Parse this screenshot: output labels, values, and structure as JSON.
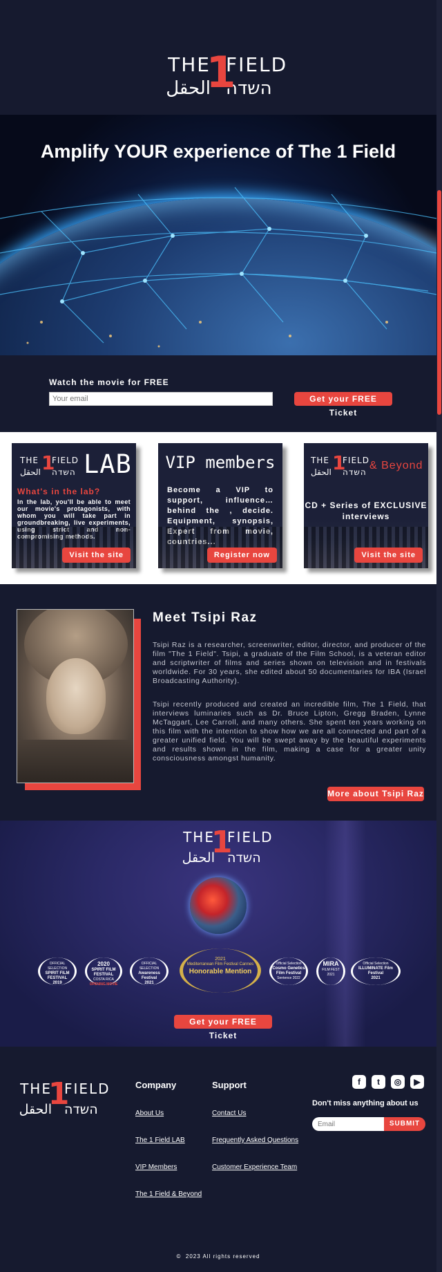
{
  "logo": {
    "the": "THE",
    "one": "1",
    "field": "FIELD",
    "arabic": "الحقل",
    "hebrew": "השדה"
  },
  "hero": {
    "headline": "Amplify YOUR experience of The 1 Field"
  },
  "signup": {
    "label": "Watch the movie for FREE",
    "placeholder": "Your email",
    "button": "Get your FREE Ticket"
  },
  "cards": {
    "lab": {
      "big": "LAB",
      "question": "What's in the lab?",
      "body": "In the lab, you'll be able to meet our movie's protagonists, with whom you will take part in groundbreaking, live experiments, using strict and non-compromising methods.",
      "button": "Visit the site"
    },
    "vip": {
      "big": "VIP members",
      "body": "Become a VIP to support, influence… behind the , decide. Equipment, synopsis, Expert from movie, countries...",
      "button": "Register now"
    },
    "beyond": {
      "amp": "& Beyond",
      "body": "CD + Series of EXCLUSIVE interviews",
      "button": "Visit the site"
    }
  },
  "meet": {
    "title": "Meet Tsipi Raz",
    "p1": "Tsipi Raz is a researcher, screenwriter, editor, director, and producer of the film \"The 1 Field\". Tsipi, a graduate of the Film School, is a veteran editor and scriptwriter of films and series shown on television and in festivals worldwide. For 30 years, she edited about 50 documentaries for IBA (Israel Broadcasting Authority).",
    "p2": "Tsipi recently produced and created an incredible film, The 1 Field, that interviews luminaries such as Dr. Bruce Lipton, Gregg Braden, Lynne McTaggart, Lee Carroll, and many others. She spent ten years working on this film with the intention to show how we are all connected and part of a greater unified field. You will be swept away by the beautiful experiments and results shown in the film, making a case for a greater unity consciousness amongst humanity.",
    "button": "More about Tsipi Raz"
  },
  "awards": {
    "laurels": [
      {
        "l1": "OFFICIAL SELECTION",
        "l2": "SPIRIT FILM FESTIVAL",
        "l3": "2019",
        "red": ""
      },
      {
        "l1": "2020",
        "l2": "SPIRIT FILM FESTIVAL",
        "l3": "COSTA RICA",
        "red": "OPENING MOVIE"
      },
      {
        "l1": "OFFICIAL SELECTION",
        "l2": "Awareness Festival",
        "l3": "2021",
        "red": ""
      },
      {
        "l1": "Official Selection",
        "l2": "Cosmo Genetics Film Festival",
        "l3": "Sentence 2022",
        "red": ""
      },
      {
        "l1": "MIRA",
        "l2": "FILM FEST",
        "l3": "2021",
        "red": ""
      },
      {
        "l1": "Official Selection",
        "l2": "ILLUMINATE Film Festival",
        "l3": "2021",
        "red": ""
      }
    ],
    "honor": {
      "year": "2021",
      "festival": "Mediterranean Film Festival Cannes",
      "mention": "Honorable Mention"
    },
    "button": "Get your FREE Ticket"
  },
  "footer": {
    "company": {
      "title": "Company",
      "links": [
        "About Us",
        "The 1 Field LAB",
        "VIP Members",
        "The 1 Field & Beyond"
      ]
    },
    "support": {
      "title": "Support",
      "links": [
        "Contact Us",
        "Frequently Asked Questions",
        "Customer Experience Team"
      ]
    },
    "social": [
      "facebook-icon",
      "twitter-icon",
      "instagram-icon",
      "youtube-icon"
    ],
    "newsletter": {
      "label": "Don't miss anything about us",
      "placeholder": "Email",
      "button": "SUBMIT"
    },
    "copyright": "2023 All rights reserved"
  },
  "colors": {
    "accent": "#e8463f",
    "navy": "#161a2f"
  }
}
